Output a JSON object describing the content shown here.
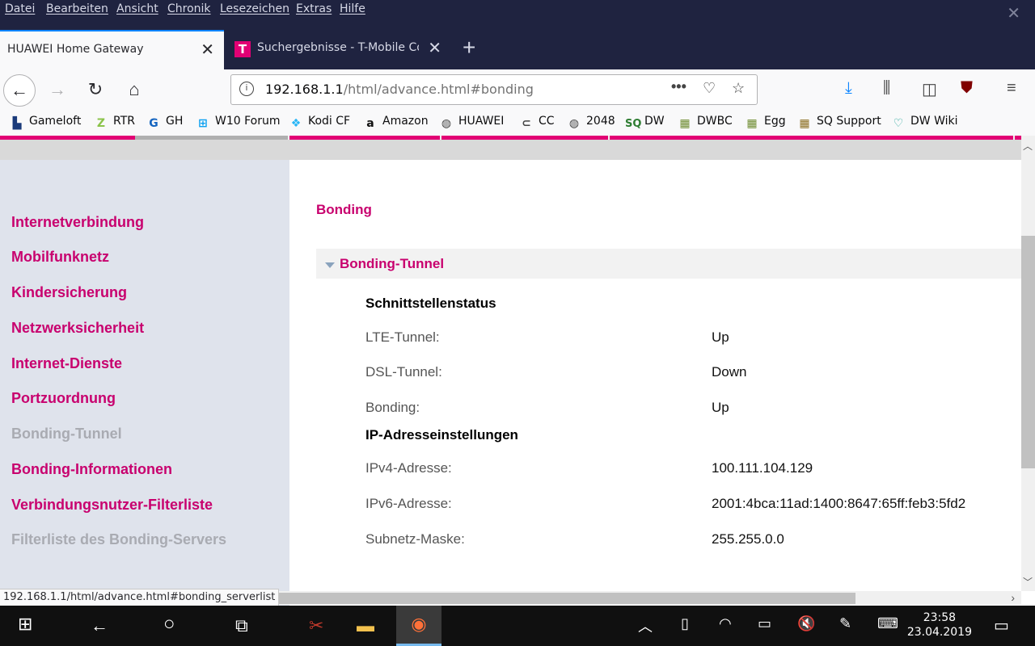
{
  "menubar": {
    "items": [
      "Datei",
      "Bearbeiten",
      "Ansicht",
      "Chronik",
      "Lesezeichen",
      "Extras",
      "Hilfe"
    ]
  },
  "tabs": [
    {
      "title": "HUAWEI Home Gateway",
      "active": true
    },
    {
      "title": "Suchergebnisse - T-Mobile Co",
      "active": false
    }
  ],
  "navbar": {
    "url_host": "192.168.1.1",
    "url_path": "/html/advance.html#bonding"
  },
  "bookmarks": [
    {
      "label": "Gameloft",
      "icon": "gameloft-icon"
    },
    {
      "label": "RTR",
      "icon": "rtr-icon"
    },
    {
      "label": "GH",
      "icon": "gh-icon"
    },
    {
      "label": "W10 Forum",
      "icon": "windows-icon"
    },
    {
      "label": "Kodi CF",
      "icon": "kodi-icon"
    },
    {
      "label": "Amazon",
      "icon": "amazon-icon"
    },
    {
      "label": "HUAWEI",
      "icon": "globe-icon"
    },
    {
      "label": "CC",
      "icon": "cc-icon"
    },
    {
      "label": "2048",
      "icon": "globe-icon"
    },
    {
      "label": "DW",
      "icon": "sq-icon"
    },
    {
      "label": "DWBC",
      "icon": "game-icon"
    },
    {
      "label": "Egg",
      "icon": "game-icon"
    },
    {
      "label": "SQ Support",
      "icon": "game-icon"
    },
    {
      "label": "DW Wiki",
      "icon": "heart-icon"
    }
  ],
  "sidebar": {
    "items": [
      {
        "label": "Internetverbindung",
        "disabled": false
      },
      {
        "label": "Mobilfunknetz",
        "disabled": false
      },
      {
        "label": "Kindersicherung",
        "disabled": false
      },
      {
        "label": "Netzwerksicherheit",
        "disabled": false
      },
      {
        "label": "Internet-Dienste",
        "disabled": false
      },
      {
        "label": "Portzuordnung",
        "disabled": false
      },
      {
        "label": "Bonding-Tunnel",
        "disabled": true
      },
      {
        "label": "Bonding-Informationen",
        "disabled": false
      },
      {
        "label": "Verbindungsnutzer-Filterliste",
        "disabled": false
      },
      {
        "label": "Filterliste des Bonding-Servers",
        "disabled": true
      }
    ]
  },
  "content": {
    "title": "Bonding",
    "section_title": "Bonding-Tunnel",
    "groups": [
      {
        "heading": "Schnittstellenstatus",
        "rows": [
          {
            "label": "LTE-Tunnel:",
            "value": "Up"
          },
          {
            "label": "DSL-Tunnel:",
            "value": "Down"
          },
          {
            "label": "Bonding:",
            "value": "Up"
          }
        ]
      },
      {
        "heading": "IP-Adresseinstellungen",
        "rows": [
          {
            "label": "IPv4-Adresse:",
            "value": "100.111.104.129"
          },
          {
            "label": "IPv6-Adresse:",
            "value": "2001:4bca:11ad:1400:8647:65ff:feb3:5fd2"
          },
          {
            "label": "Subnetz-Maske:",
            "value": "255.255.0.0"
          }
        ]
      }
    ]
  },
  "status_url": "192.168.1.1/html/advance.html#bonding_serverlist",
  "taskbar": {
    "time": "23:58",
    "date": "23.04.2019"
  },
  "colors": {
    "brand": "#e20074",
    "link": "#c8006e",
    "sidebar_bg": "#dfe3ec",
    "chrome_dark": "#1f2340"
  }
}
